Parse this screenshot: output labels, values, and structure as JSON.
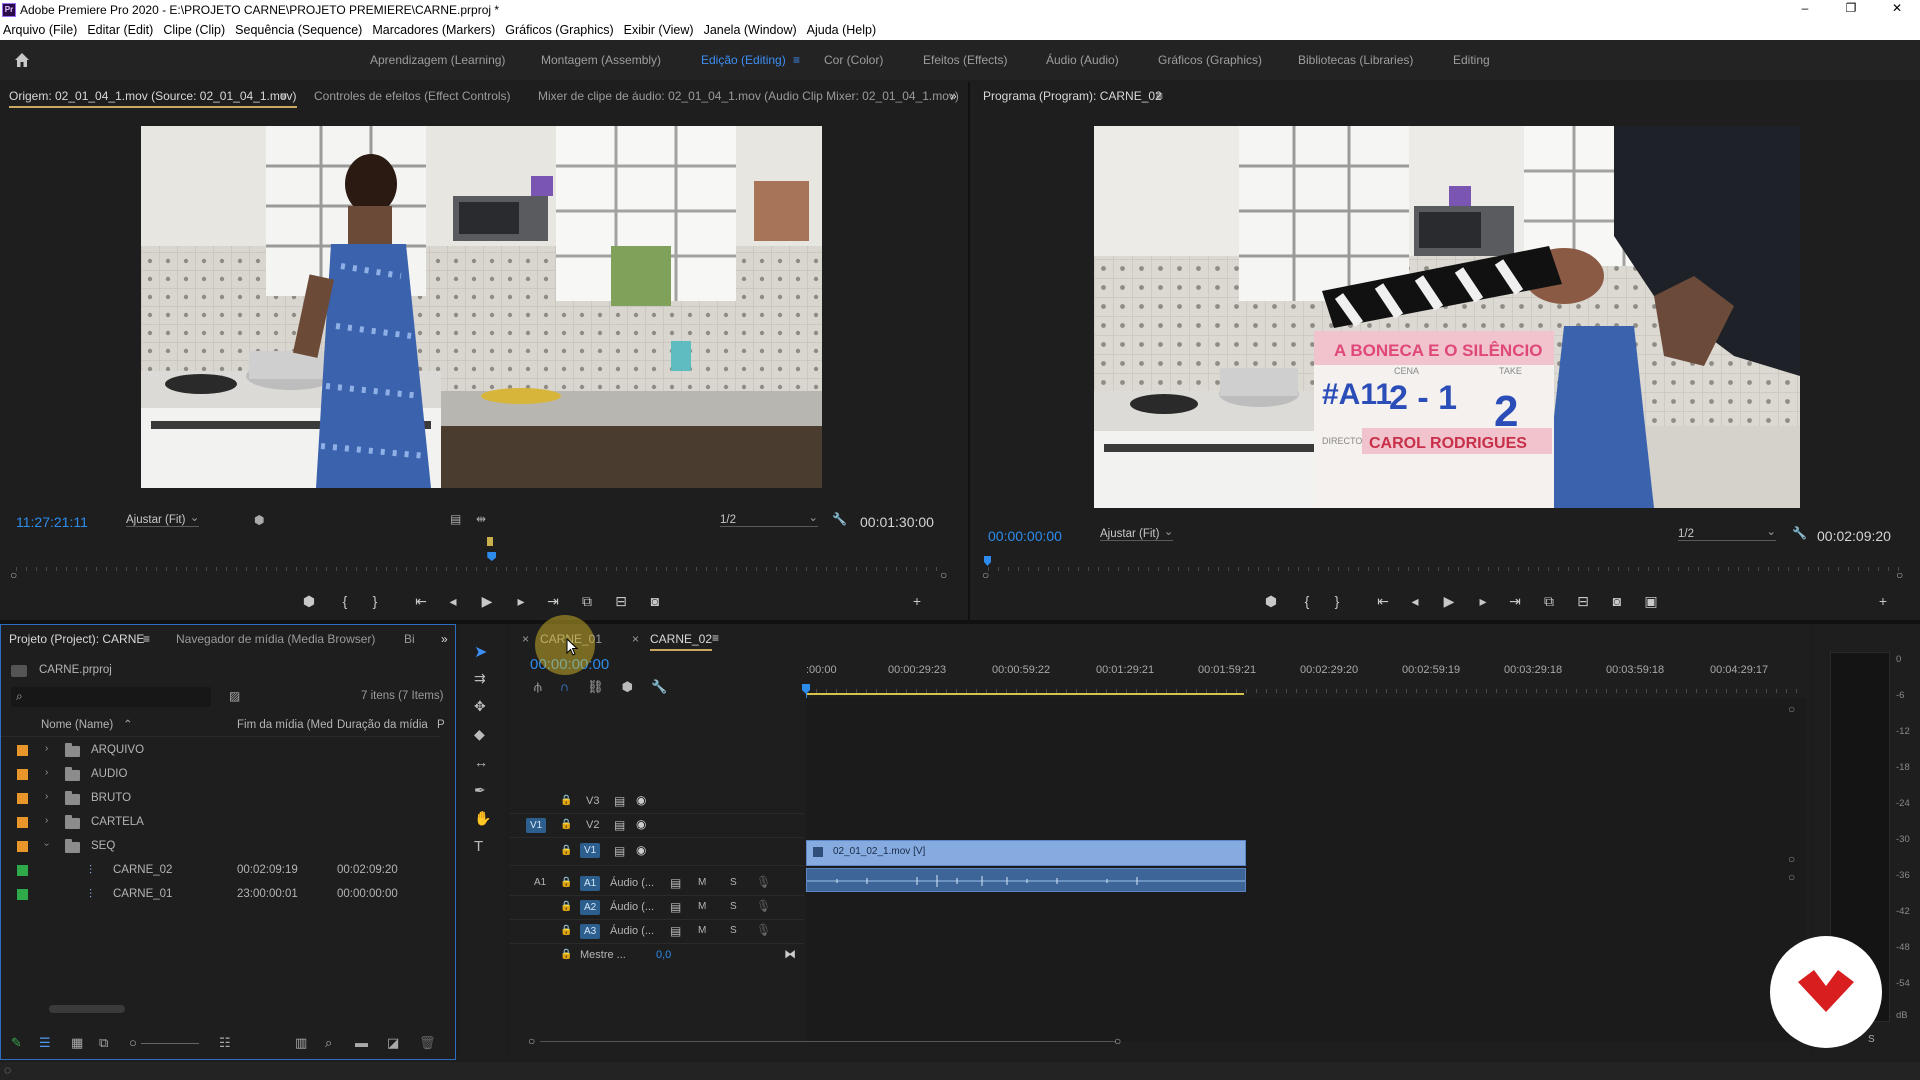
{
  "app": {
    "title": "Adobe Premiere Pro 2020 - E:\\PROJETO CARNE\\PROJETO PREMIERE\\CARNE.prproj *",
    "logo_text": "Pr"
  },
  "window_controls": {
    "minimize": "–",
    "maximize": "❐",
    "close": "✕"
  },
  "menu": [
    "Arquivo (File)",
    "Editar (Edit)",
    "Clipe (Clip)",
    "Sequência (Sequence)",
    "Marcadores (Markers)",
    "Gráficos (Graphics)",
    "Exibir (View)",
    "Janela (Window)",
    "Ajuda (Help)"
  ],
  "workspaces": [
    {
      "label": "Aprendizagem (Learning)"
    },
    {
      "label": "Montagem (Assembly)"
    },
    {
      "label": "Edição (Editing)",
      "active": true
    },
    {
      "label": "Cor (Color)"
    },
    {
      "label": "Efeitos (Effects)"
    },
    {
      "label": "Áudio (Audio)"
    },
    {
      "label": "Gráficos (Graphics)"
    },
    {
      "label": "Bibliotecas (Libraries)"
    },
    {
      "label": "Editing"
    }
  ],
  "source_monitor": {
    "tabs": [
      "Origem: 02_01_04_1.mov (Source: 02_01_04_1.mov)",
      "Controles de efeitos (Effect Controls)",
      "Mixer de clipe de áudio: 02_01_04_1.mov (Audio Clip Mixer: 02_01_04_1.mov)"
    ],
    "timecode": "11:27:21:11",
    "fit": "Ajustar (Fit)",
    "resolution": "1/2",
    "duration": "00:01:30:00",
    "playhead_fraction": 0.51
  },
  "program_monitor": {
    "tab": "Programa (Program): CARNE_02",
    "timecode": "00:00:00:00",
    "fit": "Ajustar (Fit)",
    "resolution": "1/2",
    "duration": "00:02:09:20",
    "slate": {
      "title": "A BONECA E O SILÊNCIO",
      "scene_label": "CENA",
      "take_label": "TAKE",
      "director_label": "DIRECTOR",
      "roll": "#A11",
      "scene": "2 - 1",
      "take": "2",
      "director": "CAROL RODRIGUES"
    }
  },
  "project_panel": {
    "tabs": [
      "Projeto (Project): CARNE",
      "Navegador de mídia (Media Browser)",
      "Bi"
    ],
    "file": "CARNE.prproj",
    "item_count": "7 itens (7 Items)",
    "columns": {
      "name": "Nome (Name)",
      "media_end": "Fim da mídia (Med",
      "media_duration": "Duração da mídia",
      "extra": "P"
    },
    "items": [
      {
        "name": "ARQUIVO",
        "type": "folder",
        "color": "#e8962a",
        "expanded": false
      },
      {
        "name": "AUDIO",
        "type": "folder",
        "color": "#e8962a",
        "expanded": false
      },
      {
        "name": "BRUTO",
        "type": "folder",
        "color": "#e8962a",
        "expanded": false
      },
      {
        "name": "CARTELA",
        "type": "folder",
        "color": "#e8962a",
        "expanded": false
      },
      {
        "name": "SEQ",
        "type": "folder",
        "color": "#e8962a",
        "expanded": true
      },
      {
        "name": "CARNE_02",
        "type": "sequence",
        "color": "#2faa4a",
        "media_end": "00:02:09:19",
        "media_duration": "00:02:09:20"
      },
      {
        "name": "CARNE_01",
        "type": "sequence",
        "color": "#2faa4a",
        "media_end": "23:00:00:01",
        "media_duration": "00:00:00:00"
      }
    ]
  },
  "timeline": {
    "tabs": [
      {
        "label": "CARNE_01",
        "active": false
      },
      {
        "label": "CARNE_02",
        "active": true
      }
    ],
    "timecode": "00:00:00:00",
    "ruler_labels": [
      ":00:00",
      "00:00:29:23",
      "00:00:59:22",
      "00:01:29:21",
      "00:01:59:21",
      "00:02:29:20",
      "00:02:59:19",
      "00:03:29:18",
      "00:03:59:18",
      "00:04:29:17"
    ],
    "video_tracks": [
      "V3",
      "V2",
      "V1"
    ],
    "source_patch_video": "V1",
    "source_patch_audio": "A1",
    "audio_tracks": [
      {
        "id": "A1",
        "name": "Áudio (..."
      },
      {
        "id": "A2",
        "name": "Áudio (..."
      },
      {
        "id": "A3",
        "name": "Áudio (..."
      }
    ],
    "master": {
      "label": "Mestre ...",
      "value": "0,0"
    },
    "track_buttons": {
      "mute": "M",
      "solo": "S"
    },
    "video_clip": {
      "label": "02_01_02_1.mov [V]"
    }
  },
  "audio_meter": {
    "scale": [
      "0",
      "-6",
      "-12",
      "-18",
      "-24",
      "-30",
      "-36",
      "-42",
      "-48",
      "-54",
      "dB"
    ],
    "solo_label": "S"
  }
}
